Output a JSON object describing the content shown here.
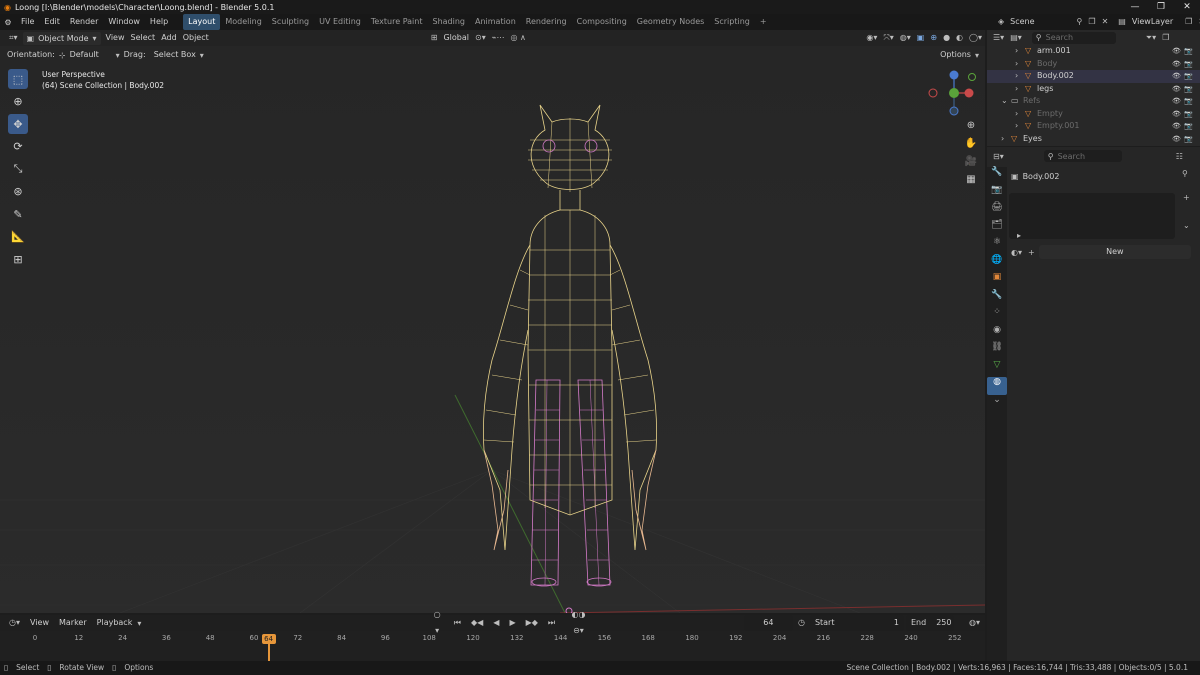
{
  "window": {
    "title": "Loong [I:\\Blender\\models\\Character\\Loong.blend] - Blender 5.0.1",
    "controls": [
      "—",
      "❐",
      "✕"
    ]
  },
  "menubar": {
    "menus": [
      "File",
      "Edit",
      "Render",
      "Window",
      "Help"
    ],
    "workspaces": [
      "Layout",
      "Modeling",
      "Sculpting",
      "UV Editing",
      "Texture Paint",
      "Shading",
      "Animation",
      "Rendering",
      "Compositing",
      "Geometry Nodes",
      "Scripting"
    ],
    "active_workspace": "Layout",
    "add_tab": "+",
    "scene_label": "Scene",
    "viewlayer_label": "ViewLayer"
  },
  "viewport": {
    "mode": "Object Mode",
    "menus": [
      "View",
      "Select",
      "Add",
      "Object"
    ],
    "transform_orientation": "Global",
    "orientation_label": "Orientation:",
    "orientation_value": "Default",
    "drag_label": "Drag:",
    "drag_value": "Select Box",
    "options_label": "Options",
    "info_line1": "User Perspective",
    "info_line2": "(64) Scene Collection | Body.002",
    "accent_color": "#e8d38a",
    "selected_color": "#d47bc8"
  },
  "outliner": {
    "search_placeholder": "Search",
    "rows": [
      {
        "name": "arm.001",
        "dim": false
      },
      {
        "name": "Body",
        "dim": true
      },
      {
        "name": "Body.002",
        "dim": false
      },
      {
        "name": "legs",
        "dim": false
      },
      {
        "name": "Refs",
        "dim": true
      },
      {
        "name": "Empty",
        "dim": true
      },
      {
        "name": "Empty.001",
        "dim": true
      },
      {
        "name": "Eyes",
        "dim": false
      }
    ]
  },
  "properties": {
    "search_placeholder": "Search",
    "object_name": "Body.002",
    "new_button": "New"
  },
  "timeline": {
    "menus": [
      "View",
      "Marker",
      "Playback"
    ],
    "current_frame": "64",
    "start_label": "Start",
    "start_value": "1",
    "end_label": "End",
    "end_value": "250",
    "ticks": [
      "0",
      "12",
      "24",
      "36",
      "48",
      "60",
      "72",
      "84",
      "96",
      "108",
      "120",
      "132",
      "144",
      "156",
      "168",
      "180",
      "192",
      "204",
      "216",
      "228",
      "240",
      "252"
    ]
  },
  "statusbar": {
    "select": "Select",
    "rotate": "Rotate View",
    "options": "Options",
    "stats": "Scene Collection | Body.002 | Verts:16,963 | Faces:16,744 | Tris:33,488 | Objects:0/5 | 5.0.1"
  }
}
